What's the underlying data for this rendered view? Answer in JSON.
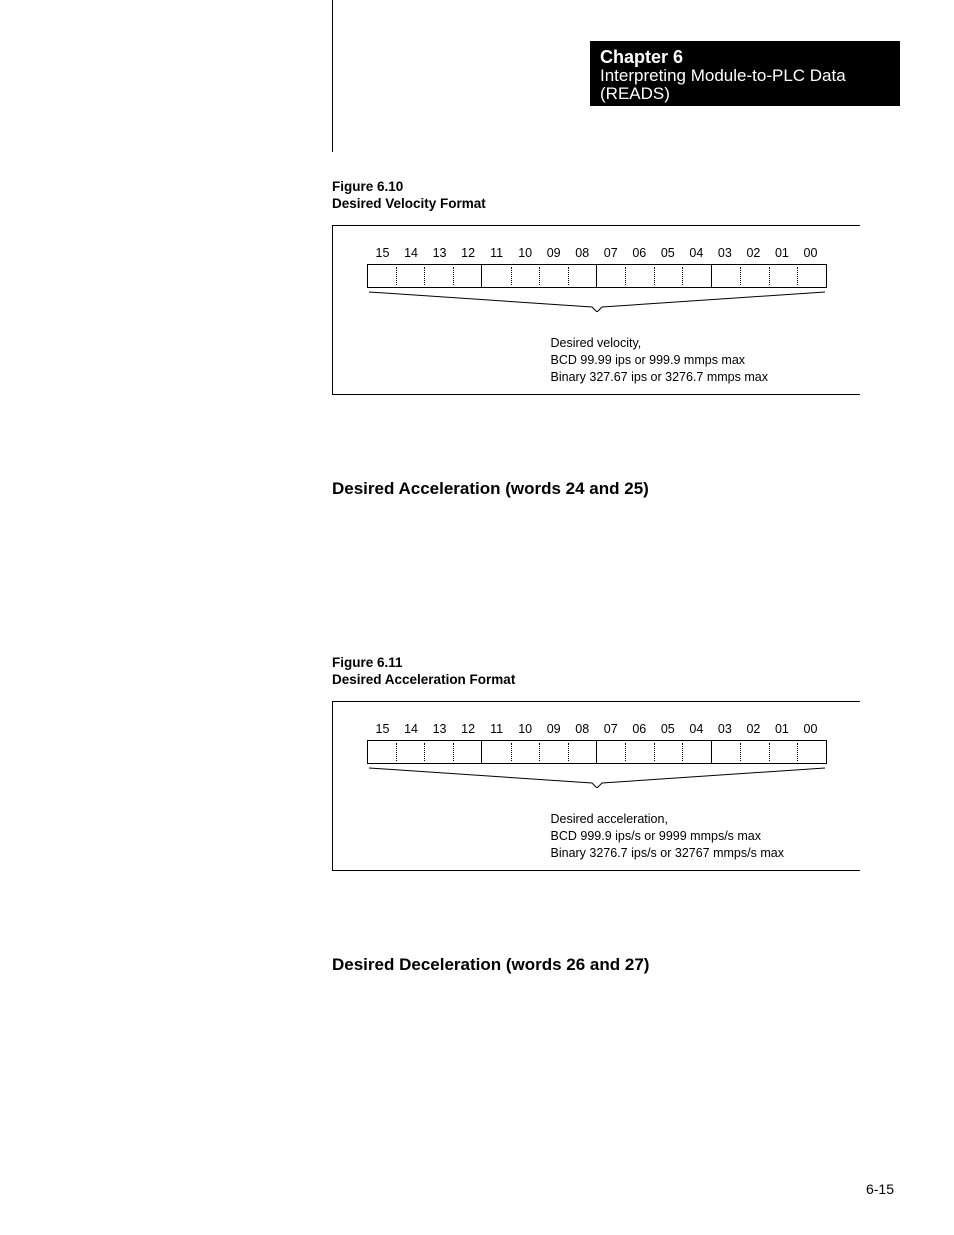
{
  "header": {
    "chapter": "Chapter 6",
    "title_l1": "Interpreting Module-to-PLC Data",
    "title_l2": "(READS)"
  },
  "fig1": {
    "num": "Figure 6.10",
    "title": "Desired Velocity Format",
    "bits": [
      "15",
      "14",
      "13",
      "12",
      "11",
      "10",
      "09",
      "08",
      "07",
      "06",
      "05",
      "04",
      "03",
      "02",
      "01",
      "00"
    ],
    "desc_l1": "Desired velocity,",
    "desc_l2": "BCD 99.99 ips or 999.9 mmps max",
    "desc_l3": "Binary 327.67 ips or 3276.7 mmps max"
  },
  "section1": "Desired Acceleration (words 24 and 25)",
  "fig2": {
    "num": "Figure 6.11",
    "title": "Desired Acceleration Format",
    "bits": [
      "15",
      "14",
      "13",
      "12",
      "11",
      "10",
      "09",
      "08",
      "07",
      "06",
      "05",
      "04",
      "03",
      "02",
      "01",
      "00"
    ],
    "desc_l1": "Desired acceleration,",
    "desc_l2": "BCD 999.9 ips/s or 9999 mmps/s max",
    "desc_l3": "Binary 3276.7 ips/s or 32767 mmps/s max"
  },
  "section2": "Desired Deceleration (words 26 and 27)",
  "pagenum": "6-15"
}
